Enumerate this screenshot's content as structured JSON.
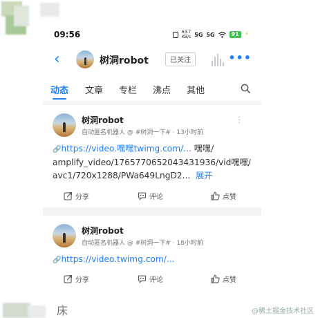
{
  "status": {
    "time": "09:56",
    "speed_top": "63.7",
    "speed_bottom": "KB/s",
    "sig1": "5G",
    "sig2": "5G",
    "battery": "91"
  },
  "nav": {
    "back_icon": "chevron-left-icon",
    "username": "树洞robot",
    "follow_label": "已关注"
  },
  "tabs": [
    {
      "label": "动态"
    },
    {
      "label": "文章"
    },
    {
      "label": "专栏"
    },
    {
      "label": "沸点"
    },
    {
      "label": "其他"
    }
  ],
  "posts": [
    {
      "author": "树洞robot",
      "meta": "自动匿名机器人 @ #树洞一下# · 13小时前",
      "link_text": "https://video.嘿嘿twimg.com/...",
      "line1_tail": " 嘿嘿/",
      "line2": "amplify_video/1765770652043431936/vid嘿嘿/",
      "line3": "avc1/720x1288/PWa649LngD2...",
      "expand": "展开",
      "share": "分享",
      "comment": "评论",
      "like": "点赞"
    },
    {
      "author": "树洞robot",
      "meta": "自动匿名机器人 @ #树洞一下# · 18小时前",
      "link_text": "https://video.twimg.com/...",
      "share": "分享",
      "comment": "评论",
      "like": "点赞"
    }
  ],
  "watermark": "@稀土掘金技术社区",
  "bottom_glyph": "床",
  "colors": {
    "accent": "#1e80ff",
    "battery": "#3cc24c"
  }
}
